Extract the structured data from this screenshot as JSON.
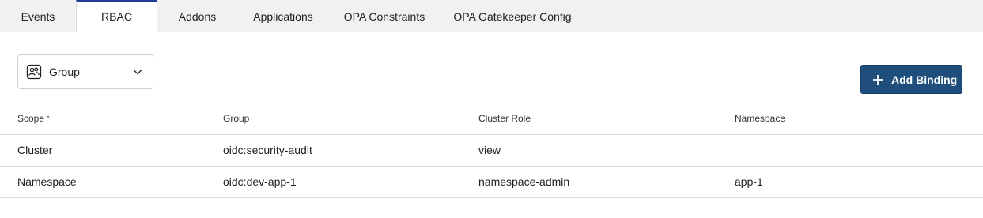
{
  "tabs": [
    {
      "label": "Events",
      "active": false
    },
    {
      "label": "RBAC",
      "active": true
    },
    {
      "label": "Addons",
      "active": false
    },
    {
      "label": "Applications",
      "active": false
    },
    {
      "label": "OPA Constraints",
      "active": false
    },
    {
      "label": "OPA Gatekeeper Config",
      "active": false
    }
  ],
  "binding_type_select": {
    "value": "Group",
    "icon": "group-icon"
  },
  "add_binding_button": {
    "label": "Add Binding",
    "icon": "plus-icon"
  },
  "table": {
    "columns": [
      {
        "label": "Scope",
        "sorted": "ascending",
        "sort_glyph": "^"
      },
      {
        "label": "Group"
      },
      {
        "label": "Cluster Role"
      },
      {
        "label": "Namespace"
      }
    ],
    "rows": [
      {
        "scope": "Cluster",
        "group": "oidc:security-audit",
        "cluster_role": "view",
        "namespace": ""
      },
      {
        "scope": "Namespace",
        "group": "oidc:dev-app-1",
        "cluster_role": "namespace-admin",
        "namespace": "app-1"
      }
    ]
  },
  "colors": {
    "accent": "#1f3a93",
    "button_bg": "#1f4e7c",
    "tabbar_bg": "#f1f1f1"
  }
}
